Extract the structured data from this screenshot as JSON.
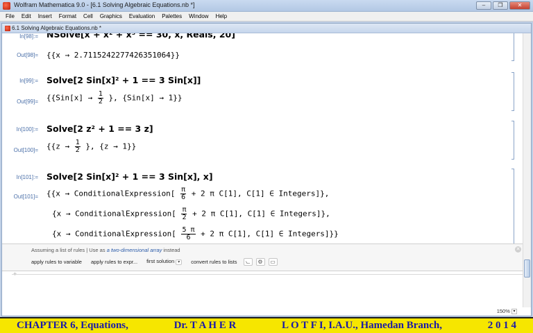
{
  "window": {
    "title": "Wolfram Mathematica 9.0 - [6.1 Solving Algebraic Equations.nb *]"
  },
  "menu": [
    "File",
    "Edit",
    "Insert",
    "Format",
    "Cell",
    "Graphics",
    "Evaluation",
    "Palettes",
    "Window",
    "Help"
  ],
  "notebook": {
    "title": "6.1 Solving Algebraic Equations.nb *"
  },
  "cells": {
    "in98": {
      "label": "In[98]:=",
      "code": "NSolve[x + x² + x³ == 30, x, Reals, 20]"
    },
    "out98": {
      "label": "Out[98]=",
      "code": "{{x → 2.7115242277426351064}}"
    },
    "in99": {
      "label": "In[99]:=",
      "code": "Solve[2 Sin[x]² + 1 == 3 Sin[x]]"
    },
    "out99": {
      "label": "Out[99]=",
      "pre": "{{Sin[x] →",
      "num": "1",
      "den": "2",
      "post": "}, {Sin[x] → 1}}"
    },
    "in100": {
      "label": "In[100]:=",
      "code": "Solve[2 z² + 1 == 3 z]"
    },
    "out100": {
      "label": "Out[100]=",
      "pre": "{{z →",
      "num": "1",
      "den": "2",
      "post": "}, {z → 1}}"
    },
    "in101": {
      "label": "In[101]:=",
      "code": "Solve[2 Sin[x]² + 1 == 3 Sin[x], x]"
    },
    "out101": {
      "label": "Out[101]=",
      "rows": [
        {
          "pre": "{{x → ConditionalExpression[",
          "num": "π",
          "den": "6",
          "post": "+ 2 π C[1], C[1] ∈ Integers]},",
          "open": "{"
        },
        {
          "pre": "{x → ConditionalExpression[",
          "num": "π",
          "den": "2",
          "post": "+ 2 π C[1], C[1] ∈ Integers]},",
          "open": "{"
        },
        {
          "pre": "{x → ConditionalExpression[",
          "num": "5 π",
          "den": "6",
          "post": "+ 2 π C[1], C[1] ∈ Integers]}}",
          "open": "{"
        }
      ]
    }
  },
  "suggestions": {
    "header_prefix": "Assuming a list of rules",
    "header_sep": "|",
    "header_use": "Use as",
    "header_link": "a two-dimensional array",
    "header_suffix": "instead",
    "buttons": [
      "apply rules to variable",
      "apply rules to expr...",
      "first solution",
      "convert rules to lists"
    ]
  },
  "zoom": "150%",
  "banner": {
    "part1": "CHAPTER 6, Equations,",
    "part2": "Dr.  T A H E R",
    "part3": "L O T F I, I.A.U., Hamedan Branch,",
    "part4": "2 0 1 4"
  }
}
